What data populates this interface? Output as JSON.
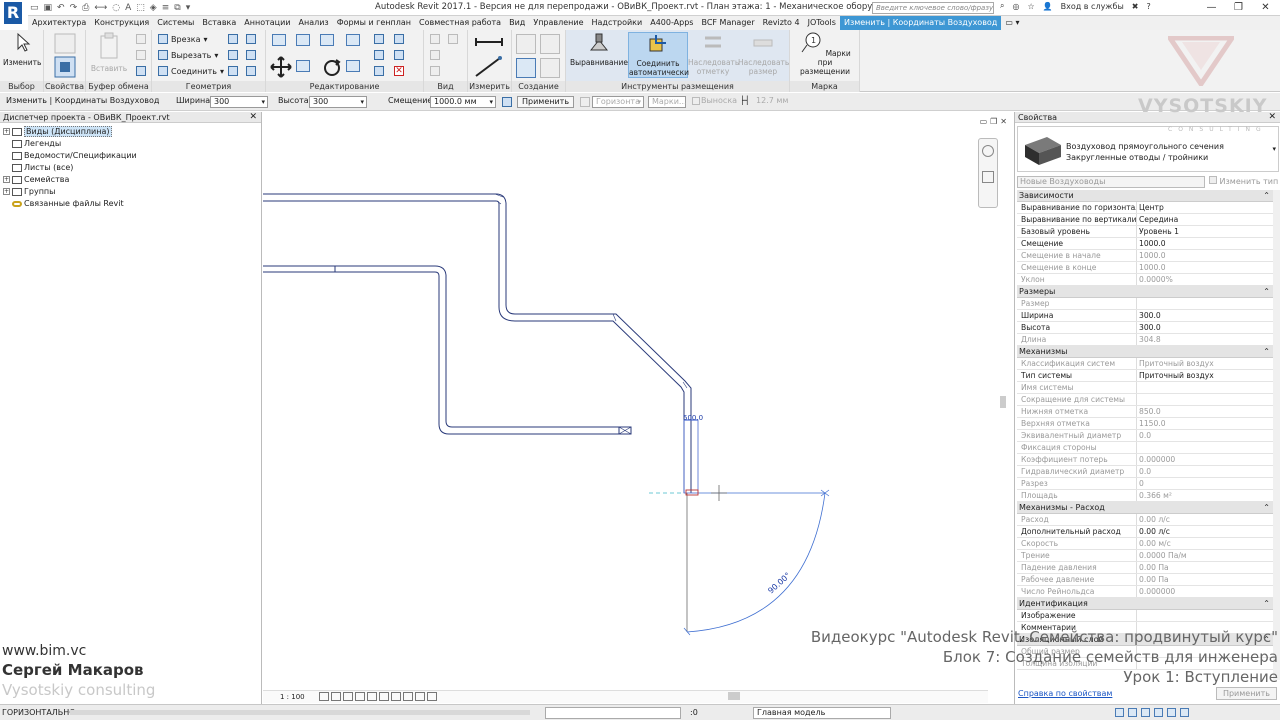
{
  "titlebar": {
    "app_letter": "R",
    "title": "Autodesk Revit 2017.1 - Версия не для перепродажи -   ОВиВК_Проект.rvt - План этажа: 1 - Механическое оборудование",
    "search_placeholder": "Введите ключевое слово/фразу",
    "login": "Вход в службы",
    "help": "?",
    "window_controls": [
      "—",
      "❐",
      "✕"
    ]
  },
  "tabs": [
    {
      "label": "Архитектура",
      "active": false
    },
    {
      "label": "Конструкция",
      "active": false
    },
    {
      "label": "Системы",
      "active": false
    },
    {
      "label": "Вставка",
      "active": false
    },
    {
      "label": "Аннотации",
      "active": false
    },
    {
      "label": "Анализ",
      "active": false
    },
    {
      "label": "Формы и генплан",
      "active": false
    },
    {
      "label": "Совместная работа",
      "active": false
    },
    {
      "label": "Вид",
      "active": false
    },
    {
      "label": "Управление",
      "active": false
    },
    {
      "label": "Надстройки",
      "active": false
    },
    {
      "label": "A400-Apps",
      "active": false
    },
    {
      "label": "BCF Manager",
      "active": false
    },
    {
      "label": "Revizto 4",
      "active": false
    },
    {
      "label": "JOTools",
      "active": false
    },
    {
      "label": "Изменить | Координаты Воздуховод",
      "active": true
    }
  ],
  "ribbon": {
    "modify_label": "Изменить",
    "panel_select": "Выбор",
    "panel_props": "Свойства",
    "paste_label": "Вставить",
    "panel_clipboard": "Буфер обмена",
    "cut_label": "Врезка",
    "cutout_label": "Вырезать",
    "join_label": "Соединить",
    "panel_geometry": "Геометрия",
    "panel_edit": "Редактирование",
    "panel_view": "Вид",
    "panel_measure": "Измерить",
    "panel_create": "Создание",
    "align_label": "Выравнивание",
    "autoconnect_label": "Соединить автоматически",
    "inherit_elev_label": "Наследовать отметку",
    "inherit_size_label": "Наследовать размер",
    "panel_placement": "Инструменты размещения",
    "tag_label": "Марки при размещении",
    "panel_tag": "Марка"
  },
  "optbar": {
    "context": "Изменить | Координаты Воздуховод",
    "width_label": "Ширина:",
    "width_value": "300",
    "height_label": "Высота:",
    "height_value": "300",
    "offset_label": "Смещение:",
    "offset_value": "1000.0 мм",
    "apply": "Применить",
    "horizontal": "Горизонта",
    "tags": "Марки...",
    "leader": "Выноска",
    "leader_len": "12.7 мм"
  },
  "browser": {
    "title": "Диспетчер проекта - ОВиВК_Проект.rvt",
    "items": [
      {
        "label": "Виды (Дисциплина)",
        "exp": "+",
        "selected": true
      },
      {
        "label": "Легенды",
        "exp": "",
        "selected": false
      },
      {
        "label": "Ведомости/Спецификации",
        "exp": "",
        "selected": false
      },
      {
        "label": "Листы (все)",
        "exp": "",
        "selected": false
      },
      {
        "label": "Семейства",
        "exp": "+",
        "selected": false
      },
      {
        "label": "Группы",
        "exp": "+",
        "selected": false
      },
      {
        "label": "Связанные файлы Revit",
        "exp": "",
        "selected": false
      }
    ]
  },
  "canvas": {
    "dim_label": "500.0",
    "angle_label": "90.00°",
    "scale": "1 : 100"
  },
  "props": {
    "title": "Свойства",
    "type_name": "Воздуховод прямоугольного сечения",
    "type_sub": "Закругленные отводы / тройники",
    "instance": "Новые Воздуховоды",
    "edit_type": "Изменить тип",
    "sections": [
      {
        "name": "Зависимости",
        "rows": [
          {
            "k": "Выравнивание по горизонтали",
            "v": "Центр",
            "g": false
          },
          {
            "k": "Выравнивание по вертикали",
            "v": "Середина",
            "g": false
          },
          {
            "k": "Базовый уровень",
            "v": "Уровень 1",
            "g": false
          },
          {
            "k": "Смещение",
            "v": "1000.0",
            "g": false
          },
          {
            "k": "Смещение в начале",
            "v": "1000.0",
            "g": true
          },
          {
            "k": "Смещение в конце",
            "v": "1000.0",
            "g": true
          },
          {
            "k": "Уклон",
            "v": "0.0000%",
            "g": true
          }
        ]
      },
      {
        "name": "Размеры",
        "rows": [
          {
            "k": "Размер",
            "v": "",
            "g": true
          },
          {
            "k": "Ширина",
            "v": "300.0",
            "g": false
          },
          {
            "k": "Высота",
            "v": "300.0",
            "g": false
          },
          {
            "k": "Длина",
            "v": "304.8",
            "g": true
          }
        ]
      },
      {
        "name": "Механизмы",
        "rows": [
          {
            "k": "Классификация систем",
            "v": "Приточный воздух",
            "g": true
          },
          {
            "k": "Тип системы",
            "v": "Приточный воздух",
            "g": false
          },
          {
            "k": "Имя системы",
            "v": "",
            "g": true
          },
          {
            "k": "Сокращение для системы",
            "v": "",
            "g": true
          },
          {
            "k": "Нижняя отметка",
            "v": "850.0",
            "g": true
          },
          {
            "k": "Верхняя отметка",
            "v": "1150.0",
            "g": true
          },
          {
            "k": "Эквивалентный диаметр",
            "v": "0.0",
            "g": true
          },
          {
            "k": "Фиксация стороны",
            "v": "",
            "g": true
          },
          {
            "k": "Коэффициент потерь",
            "v": "0.000000",
            "g": true
          },
          {
            "k": "Гидравлический диаметр",
            "v": "0.0",
            "g": true
          },
          {
            "k": "Разрез",
            "v": "0",
            "g": true
          },
          {
            "k": "Площадь",
            "v": "0.366 м²",
            "g": true
          }
        ]
      },
      {
        "name": "Механизмы - Расход",
        "rows": [
          {
            "k": "Расход",
            "v": "0.00 л/с",
            "g": true
          },
          {
            "k": "Дополнительный расход",
            "v": "0.00 л/с",
            "g": false
          },
          {
            "k": "Скорость",
            "v": "0.00 м/с",
            "g": true
          },
          {
            "k": "Трение",
            "v": "0.0000 Па/м",
            "g": true
          },
          {
            "k": "Падение давления",
            "v": "0.00 Па",
            "g": true
          },
          {
            "k": "Рабочее давление",
            "v": "0.00 Па",
            "g": true
          },
          {
            "k": "Число Рейнольдса",
            "v": "0.000000",
            "g": true
          }
        ]
      },
      {
        "name": "Идентификация",
        "rows": [
          {
            "k": "Изображение",
            "v": "",
            "g": false
          },
          {
            "k": "Комментарии",
            "v": "",
            "g": false
          }
        ]
      },
      {
        "name": "Изоляционный слой",
        "rows": [
          {
            "k": "Общий размер",
            "v": "",
            "g": true
          },
          {
            "k": "Толщина изоляции",
            "v": "",
            "g": true
          }
        ]
      }
    ],
    "help_link": "Справка по свойствам",
    "apply": "Применить"
  },
  "status": {
    "text": "ГОРИЗОНТАЛЬНО",
    "zero": ":0",
    "model": "Главная модель"
  },
  "overlay": {
    "site": "www.bim.vc",
    "author": "Сергей Макаров",
    "company": "Vysotskiy consulting",
    "course": "Видеокурс \"Autodesk Revit. Семейства: продвинутый курс\"",
    "block": "Блок 7: Создание семейств для инженера",
    "lesson": "Урок 1: Вступление",
    "logo": "VYSOTSKIY",
    "logo_sub": "CONSULTING"
  },
  "colors": {
    "accent": "#3e97d4",
    "duct": "#2a3a7a",
    "guide": "#3f6fd1"
  }
}
